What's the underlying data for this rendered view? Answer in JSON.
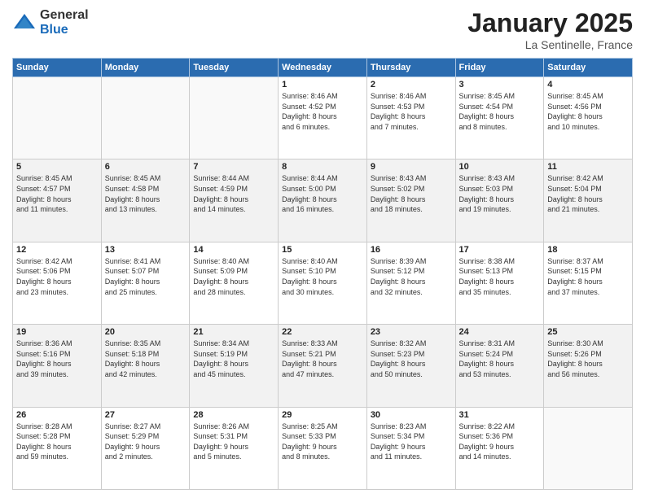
{
  "header": {
    "logo_general": "General",
    "logo_blue": "Blue",
    "month_title": "January 2025",
    "location": "La Sentinelle, France"
  },
  "weekdays": [
    "Sunday",
    "Monday",
    "Tuesday",
    "Wednesday",
    "Thursday",
    "Friday",
    "Saturday"
  ],
  "weeks": [
    [
      {
        "date": "",
        "info": ""
      },
      {
        "date": "",
        "info": ""
      },
      {
        "date": "",
        "info": ""
      },
      {
        "date": "1",
        "info": "Sunrise: 8:46 AM\nSunset: 4:52 PM\nDaylight: 8 hours\nand 6 minutes."
      },
      {
        "date": "2",
        "info": "Sunrise: 8:46 AM\nSunset: 4:53 PM\nDaylight: 8 hours\nand 7 minutes."
      },
      {
        "date": "3",
        "info": "Sunrise: 8:45 AM\nSunset: 4:54 PM\nDaylight: 8 hours\nand 8 minutes."
      },
      {
        "date": "4",
        "info": "Sunrise: 8:45 AM\nSunset: 4:56 PM\nDaylight: 8 hours\nand 10 minutes."
      }
    ],
    [
      {
        "date": "5",
        "info": "Sunrise: 8:45 AM\nSunset: 4:57 PM\nDaylight: 8 hours\nand 11 minutes."
      },
      {
        "date": "6",
        "info": "Sunrise: 8:45 AM\nSunset: 4:58 PM\nDaylight: 8 hours\nand 13 minutes."
      },
      {
        "date": "7",
        "info": "Sunrise: 8:44 AM\nSunset: 4:59 PM\nDaylight: 8 hours\nand 14 minutes."
      },
      {
        "date": "8",
        "info": "Sunrise: 8:44 AM\nSunset: 5:00 PM\nDaylight: 8 hours\nand 16 minutes."
      },
      {
        "date": "9",
        "info": "Sunrise: 8:43 AM\nSunset: 5:02 PM\nDaylight: 8 hours\nand 18 minutes."
      },
      {
        "date": "10",
        "info": "Sunrise: 8:43 AM\nSunset: 5:03 PM\nDaylight: 8 hours\nand 19 minutes."
      },
      {
        "date": "11",
        "info": "Sunrise: 8:42 AM\nSunset: 5:04 PM\nDaylight: 8 hours\nand 21 minutes."
      }
    ],
    [
      {
        "date": "12",
        "info": "Sunrise: 8:42 AM\nSunset: 5:06 PM\nDaylight: 8 hours\nand 23 minutes."
      },
      {
        "date": "13",
        "info": "Sunrise: 8:41 AM\nSunset: 5:07 PM\nDaylight: 8 hours\nand 25 minutes."
      },
      {
        "date": "14",
        "info": "Sunrise: 8:40 AM\nSunset: 5:09 PM\nDaylight: 8 hours\nand 28 minutes."
      },
      {
        "date": "15",
        "info": "Sunrise: 8:40 AM\nSunset: 5:10 PM\nDaylight: 8 hours\nand 30 minutes."
      },
      {
        "date": "16",
        "info": "Sunrise: 8:39 AM\nSunset: 5:12 PM\nDaylight: 8 hours\nand 32 minutes."
      },
      {
        "date": "17",
        "info": "Sunrise: 8:38 AM\nSunset: 5:13 PM\nDaylight: 8 hours\nand 35 minutes."
      },
      {
        "date": "18",
        "info": "Sunrise: 8:37 AM\nSunset: 5:15 PM\nDaylight: 8 hours\nand 37 minutes."
      }
    ],
    [
      {
        "date": "19",
        "info": "Sunrise: 8:36 AM\nSunset: 5:16 PM\nDaylight: 8 hours\nand 39 minutes."
      },
      {
        "date": "20",
        "info": "Sunrise: 8:35 AM\nSunset: 5:18 PM\nDaylight: 8 hours\nand 42 minutes."
      },
      {
        "date": "21",
        "info": "Sunrise: 8:34 AM\nSunset: 5:19 PM\nDaylight: 8 hours\nand 45 minutes."
      },
      {
        "date": "22",
        "info": "Sunrise: 8:33 AM\nSunset: 5:21 PM\nDaylight: 8 hours\nand 47 minutes."
      },
      {
        "date": "23",
        "info": "Sunrise: 8:32 AM\nSunset: 5:23 PM\nDaylight: 8 hours\nand 50 minutes."
      },
      {
        "date": "24",
        "info": "Sunrise: 8:31 AM\nSunset: 5:24 PM\nDaylight: 8 hours\nand 53 minutes."
      },
      {
        "date": "25",
        "info": "Sunrise: 8:30 AM\nSunset: 5:26 PM\nDaylight: 8 hours\nand 56 minutes."
      }
    ],
    [
      {
        "date": "26",
        "info": "Sunrise: 8:28 AM\nSunset: 5:28 PM\nDaylight: 8 hours\nand 59 minutes."
      },
      {
        "date": "27",
        "info": "Sunrise: 8:27 AM\nSunset: 5:29 PM\nDaylight: 9 hours\nand 2 minutes."
      },
      {
        "date": "28",
        "info": "Sunrise: 8:26 AM\nSunset: 5:31 PM\nDaylight: 9 hours\nand 5 minutes."
      },
      {
        "date": "29",
        "info": "Sunrise: 8:25 AM\nSunset: 5:33 PM\nDaylight: 9 hours\nand 8 minutes."
      },
      {
        "date": "30",
        "info": "Sunrise: 8:23 AM\nSunset: 5:34 PM\nDaylight: 9 hours\nand 11 minutes."
      },
      {
        "date": "31",
        "info": "Sunrise: 8:22 AM\nSunset: 5:36 PM\nDaylight: 9 hours\nand 14 minutes."
      },
      {
        "date": "",
        "info": ""
      }
    ]
  ]
}
